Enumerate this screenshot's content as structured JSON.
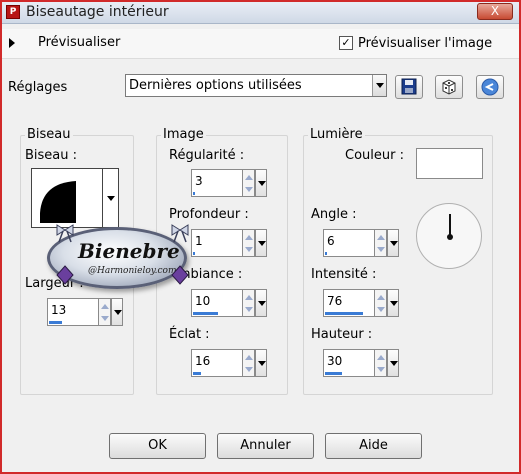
{
  "window": {
    "title": "Biseautage intérieur",
    "app_icon": "paint-shop-pro-icon",
    "close_label": "X"
  },
  "preview": {
    "label": "Prévisualiser",
    "preview_image_label": "Prévisualiser l'image",
    "preview_image_checked": true,
    "check_mark": "✓"
  },
  "settings": {
    "label": "Réglages",
    "selected": "Dernières options utilisées"
  },
  "toolbar": {
    "save_icon": "save-icon",
    "dice_icon": "randomize-icon",
    "reset_icon": "reset-icon"
  },
  "bevel": {
    "group_title": "Biseau",
    "bevel_label": "Biseau :",
    "width_label": "Largeur :",
    "width_value": "13",
    "width_fill": 0.25
  },
  "image": {
    "group_title": "Image",
    "smoothness_label": "Régularité :",
    "smoothness_value": "3",
    "smoothness_fill": 0.03,
    "depth_label": "Profondeur :",
    "depth_value": "1",
    "depth_fill": 0.01,
    "ambience_label": "Ambiance :",
    "ambience_value": "10",
    "ambience_fill": 0.5,
    "shininess_label": "Éclat :",
    "shininess_value": "16",
    "shininess_fill": 0.16
  },
  "light": {
    "group_title": "Lumière",
    "color_label": "Couleur :",
    "color_value": "#ffffff",
    "angle_label": "Angle :",
    "angle_value": "6",
    "angle_fill": 0.02,
    "intensity_label": "Intensité :",
    "intensity_value": "76",
    "intensity_fill": 0.76,
    "elevation_label": "Hauteur :",
    "elevation_value": "30",
    "elevation_fill": 0.33
  },
  "buttons": {
    "ok": "OK",
    "cancel": "Annuler",
    "help": "Aide"
  },
  "watermark": {
    "name": "Bienebre",
    "site": "@Harmonieloy.com"
  },
  "colors": {
    "accent": "#3a7bd5",
    "window_border": "#d12a2a",
    "background": "#f0f0f0"
  }
}
